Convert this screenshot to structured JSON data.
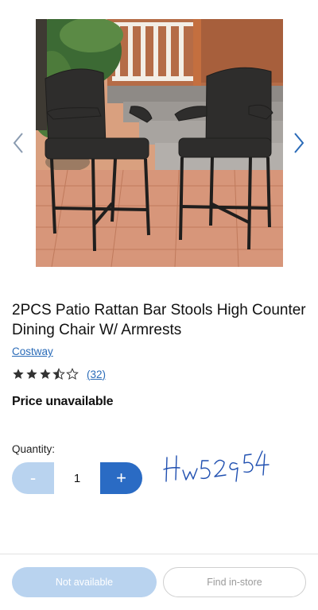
{
  "product": {
    "title": "2PCS Patio Rattan Bar Stools High Counter Dining Chair W/ Armrests",
    "brand": "Costway",
    "rating": 3.5,
    "rating_max": 5,
    "review_count": "(32)",
    "price_text": "Price unavailable",
    "image_icon": "product-photo"
  },
  "gallery": {
    "prev_icon": "chevron-left-icon",
    "next_icon": "chevron-right-icon"
  },
  "quantity": {
    "label": "Quantity:",
    "value": "1",
    "decrement_label": "-",
    "increment_label": "+"
  },
  "annotation": {
    "handwritten_text": "Hw52954"
  },
  "footer": {
    "primary_label": "Not available",
    "secondary_label": "Find in-store"
  },
  "colors": {
    "accent": "#2a6bc4",
    "accent_light": "#b9d3ef",
    "link": "#2a6bb8",
    "annotation_ink": "#1f4fb0"
  }
}
